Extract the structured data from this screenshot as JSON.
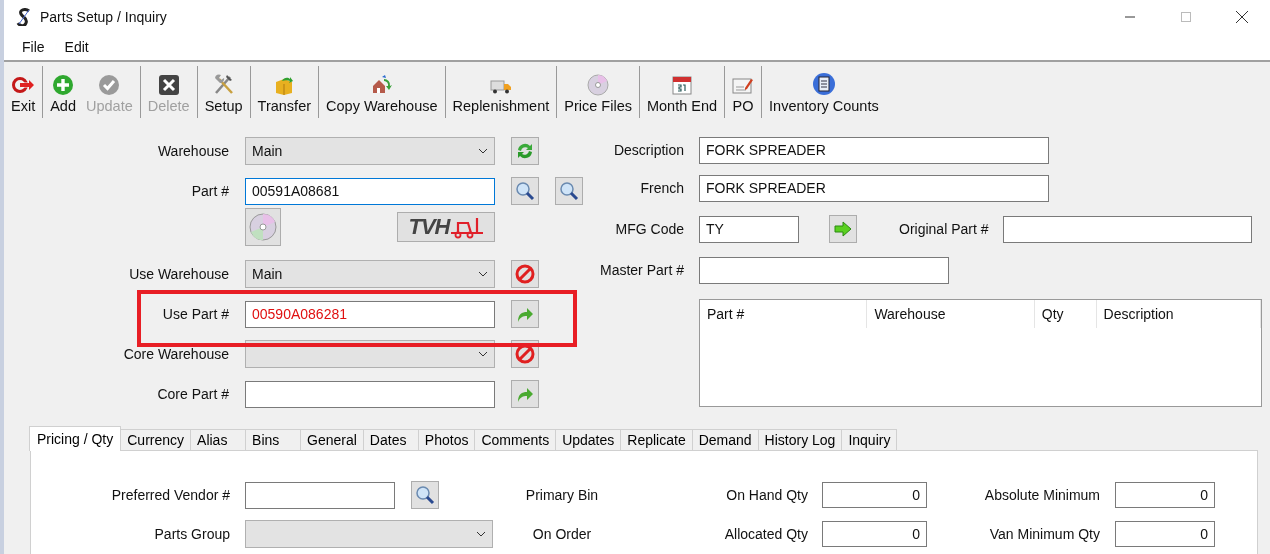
{
  "window": {
    "title": "Parts Setup / Inquiry"
  },
  "menu": [
    "File",
    "Edit"
  ],
  "toolbar": [
    [
      {
        "label": "Exit",
        "disabled": false
      }
    ],
    [
      {
        "label": "Add",
        "disabled": false
      },
      {
        "label": "Update",
        "disabled": true
      }
    ],
    [
      {
        "label": "Delete",
        "disabled": true
      }
    ],
    [
      {
        "label": "Setup",
        "disabled": false
      }
    ],
    [
      {
        "label": "Transfer",
        "disabled": false
      }
    ],
    [
      {
        "label": "Copy Warehouse",
        "disabled": false
      }
    ],
    [
      {
        "label": "Replenishment",
        "disabled": false
      }
    ],
    [
      {
        "label": "Price Files",
        "disabled": false
      }
    ],
    [
      {
        "label": "Month End",
        "disabled": false
      }
    ],
    [
      {
        "label": "PO",
        "disabled": false
      }
    ],
    [
      {
        "label": "Inventory Counts",
        "disabled": false
      }
    ]
  ],
  "part_fields": [
    {
      "kind": "dropdown",
      "label": "Warehouse",
      "value": "Main"
    },
    {
      "kind": "text",
      "label": "Part #",
      "value": "00591A08681",
      "focused": true
    },
    {
      "kind": "image_buttons",
      "logo_text": "TVH"
    },
    {
      "kind": "dropdown",
      "label": "Use Warehouse",
      "value": "Main"
    },
    {
      "kind": "text",
      "label": "Use Part #",
      "value": "00590A086281",
      "error": true,
      "highlighted": true
    },
    {
      "kind": "dropdown",
      "label": "Core Warehouse"
    },
    {
      "kind": "text",
      "label": "Core Part #"
    }
  ],
  "details": {
    "description": {
      "label": "Description",
      "value": "FORK SPREADER"
    },
    "french": {
      "label": "French",
      "value": "FORK SPREADER"
    },
    "mfg_code": {
      "label": "MFG Code",
      "value": "TY"
    },
    "original_part": {
      "label": "Original Part #"
    },
    "master_part": {
      "label": "Master Part #"
    },
    "table": {
      "columns": [
        "Part #",
        "Warehouse",
        "Qty",
        "Description"
      ]
    }
  },
  "tabs": [
    {
      "label": "Pricing / Qty",
      "selected": true
    },
    {
      "label": "Currency",
      "selected": false
    },
    {
      "label": "Alias",
      "selected": false
    },
    {
      "label": "Bins",
      "selected": false
    },
    {
      "label": "General",
      "selected": false
    },
    {
      "label": "Dates",
      "selected": false
    },
    {
      "label": "Photos",
      "selected": false
    },
    {
      "label": "Comments",
      "selected": false
    },
    {
      "label": "Updates",
      "selected": false
    },
    {
      "label": "Replicate",
      "selected": false
    },
    {
      "label": "Demand",
      "selected": false
    },
    {
      "label": "History Log",
      "selected": false
    },
    {
      "label": "Inquiry",
      "selected": false
    }
  ],
  "pricing": [
    {
      "first": {
        "kind": "text",
        "label": "Preferred Vendor #"
      },
      "middle": "Primary Bin",
      "qty": {
        "label": "On Hand Qty",
        "value": "0"
      },
      "limit": {
        "label": "Absolute Minimum",
        "value": "0"
      }
    },
    {
      "first": {
        "kind": "dropdown",
        "label": "Parts Group"
      },
      "middle": "On Order",
      "qty": {
        "label": "Allocated Qty",
        "value": "0"
      },
      "limit": {
        "label": "Van Minimum Qty",
        "value": "0"
      }
    }
  ]
}
